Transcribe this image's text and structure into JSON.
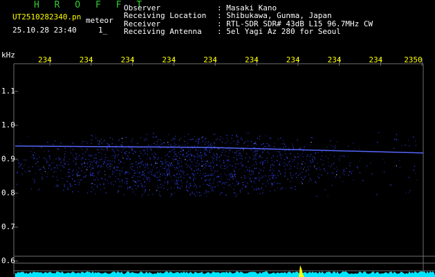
{
  "app": {
    "title": "H R O F F T",
    "filename": "UT2510282340.pn",
    "mode": "meteor",
    "datetime": "25.10.28 23:40",
    "status": "1_"
  },
  "info": {
    "rows": [
      {
        "label": "Observer",
        "value": ": Masaki Kano"
      },
      {
        "label": "Receiving Location",
        "value": ": Shibukawa, Gunma, Japan"
      },
      {
        "label": "Receiver",
        "value": ": RTL-SDR SDR# 43dB L15 96.7MHz CW"
      },
      {
        "label": "Receiving Antenna",
        "value": ": 5el Yagi Az 280 for Seoul"
      }
    ]
  },
  "chart_data": {
    "type": "heatmap",
    "ylabel": "kHz",
    "xticks": [
      "234",
      "234",
      "234",
      "234",
      "234",
      "234",
      "234",
      "234",
      "234",
      "2350"
    ],
    "yticks": [
      "1.1",
      "1.0",
      "0.9",
      "0.8",
      "0.7",
      "0.6"
    ],
    "yrange": [
      0.58,
      1.18
    ],
    "carrier_khz": 0.935,
    "echo_khz_range": [
      0.79,
      0.98
    ],
    "colors": {
      "text_green": "#33cc33",
      "text_white": "#ffffff",
      "text_yellow": "#ffff00",
      "grid": "#6f6f6f",
      "signal": "#3344ff",
      "spectrum": "#00e5ff",
      "peak": "#ffff00"
    }
  }
}
